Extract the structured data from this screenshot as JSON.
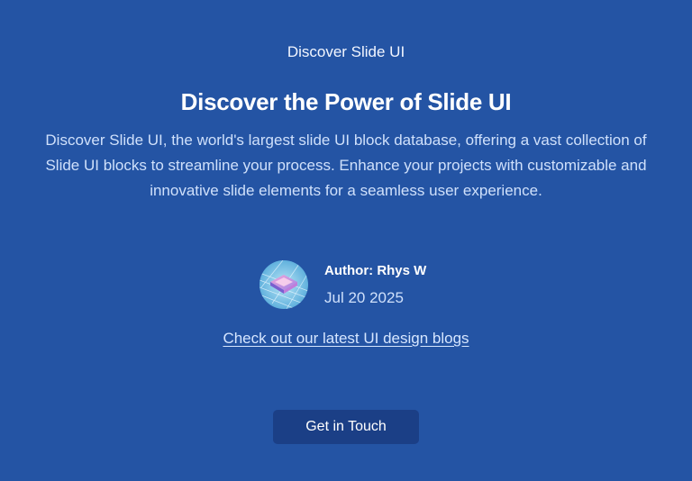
{
  "hero": {
    "eyebrow": "Discover Slide UI",
    "headline": "Discover the Power of Slide UI",
    "description": "Discover Slide UI, the world's largest slide UI block database, offering a vast collection of Slide UI blocks to streamline your process. Enhance your projects with customizable and innovative slide elements for a seamless user experience."
  },
  "author": {
    "name": "Author: Rhys W",
    "date": "Jul 20 2025"
  },
  "blog_link": "Check out our latest UI design blogs",
  "cta_label": "Get in Touch",
  "colors": {
    "background": "#2454a4",
    "button": "#1b3f86",
    "muted_text": "#cfe0fb"
  }
}
